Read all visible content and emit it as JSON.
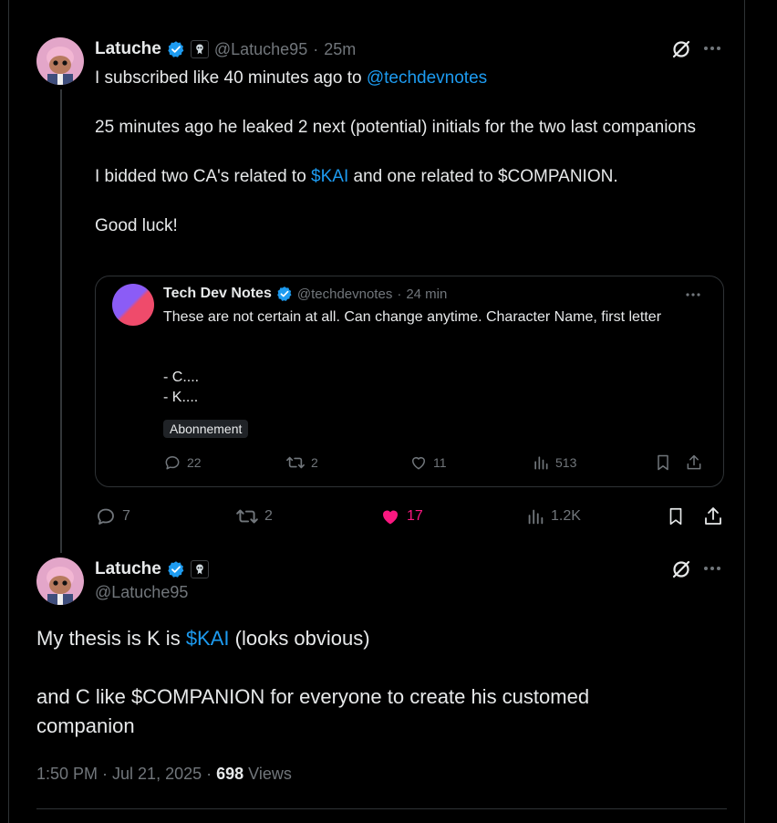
{
  "tweet1": {
    "name": "Latuche",
    "handle": "@Latuche95",
    "sep": "·",
    "time": "25m",
    "line1_prefix": "I subscribed like 40 minutes ago to ",
    "line1_mention": "@techdevnotes",
    "para2": "25 minutes ago he leaked 2 next (potential) initials for the two last companions",
    "para3_prefix": "I bidded two CA's related to ",
    "para3_cashtag": "$KAI",
    "para3_suffix": " and one related to $COMPANION.",
    "para4": "Good luck!",
    "actions": {
      "replies": "7",
      "reposts": "2",
      "likes": "17",
      "views": "1.2K"
    }
  },
  "quote": {
    "name": "Tech Dev Notes",
    "handle": "@techdevnotes",
    "sep": "·",
    "time": "24 min",
    "text": "These are not certain at all. Can change anytime. Character Name, first letter",
    "item1": "- C....",
    "item2": "- K....",
    "badge": "Abonnement",
    "actions": {
      "replies": "22",
      "reposts": "2",
      "likes": "11",
      "views": "513"
    }
  },
  "tweet2": {
    "name": "Latuche",
    "handle": "@Latuche95",
    "line1_prefix": "My thesis is K is ",
    "line1_cashtag": "$KAI",
    "line1_suffix": " (looks obvious)",
    "para2": "and C like $COMPANION for everyone to create his customed companion",
    "timestamp": "1:50 PM · Jul 21, 2025 · ",
    "views_count": "698",
    "views_label": " Views"
  },
  "colors": {
    "accent": "#1d9bf0",
    "like": "#f91880",
    "muted": "#71767b",
    "text": "#e7e9ea",
    "background": "#000000"
  }
}
